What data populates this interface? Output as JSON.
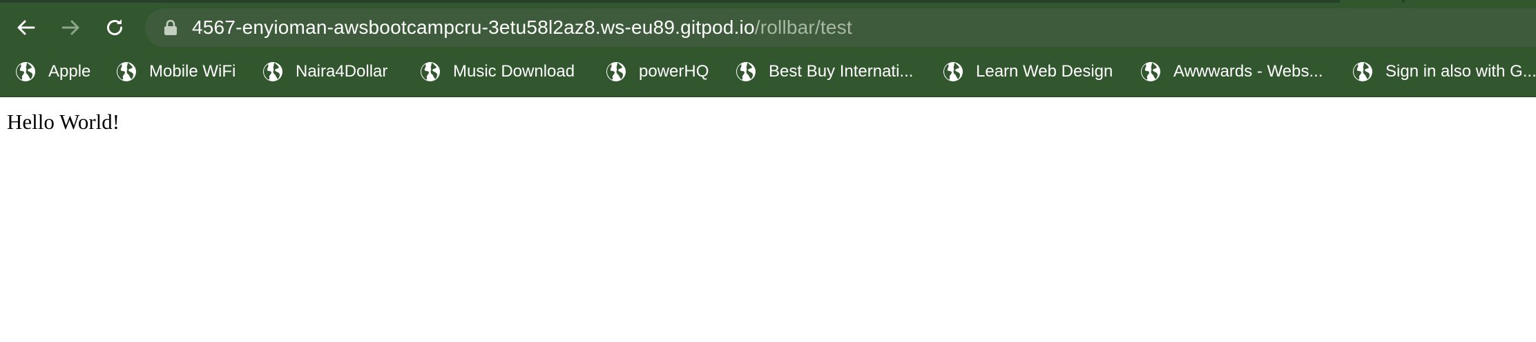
{
  "browser": {
    "back_icon": "arrow-left-icon",
    "forward_icon": "arrow-right-icon",
    "reload_icon": "reload-icon",
    "lock_icon": "lock-icon",
    "address": {
      "host": "4567-enyioman-awsbootcampcru-3etu58l2az8.ws-eu89.gitpod.io",
      "path": "/rollbar/test"
    },
    "colors": {
      "toolbar": "#32572f",
      "omnibox": "#3e5c3b",
      "url_path": "#aab8a7"
    }
  },
  "bookmarks": [
    {
      "label": "Apple",
      "icon": "globe-icon"
    },
    {
      "label": "Mobile WiFi",
      "icon": "globe-icon"
    },
    {
      "label": "Naira4Dollar",
      "icon": "globe-icon"
    },
    {
      "label": "Music Download",
      "icon": "globe-icon"
    },
    {
      "label": "powerHQ",
      "icon": "globe-icon"
    },
    {
      "label": "Best Buy Internati...",
      "icon": "globe-icon"
    },
    {
      "label": "Learn Web Design",
      "icon": "globe-icon"
    },
    {
      "label": "Awwwards - Webs...",
      "icon": "globe-icon"
    },
    {
      "label": "Sign in also with G...",
      "icon": "globe-icon"
    }
  ],
  "page": {
    "body_text": "Hello World!"
  }
}
